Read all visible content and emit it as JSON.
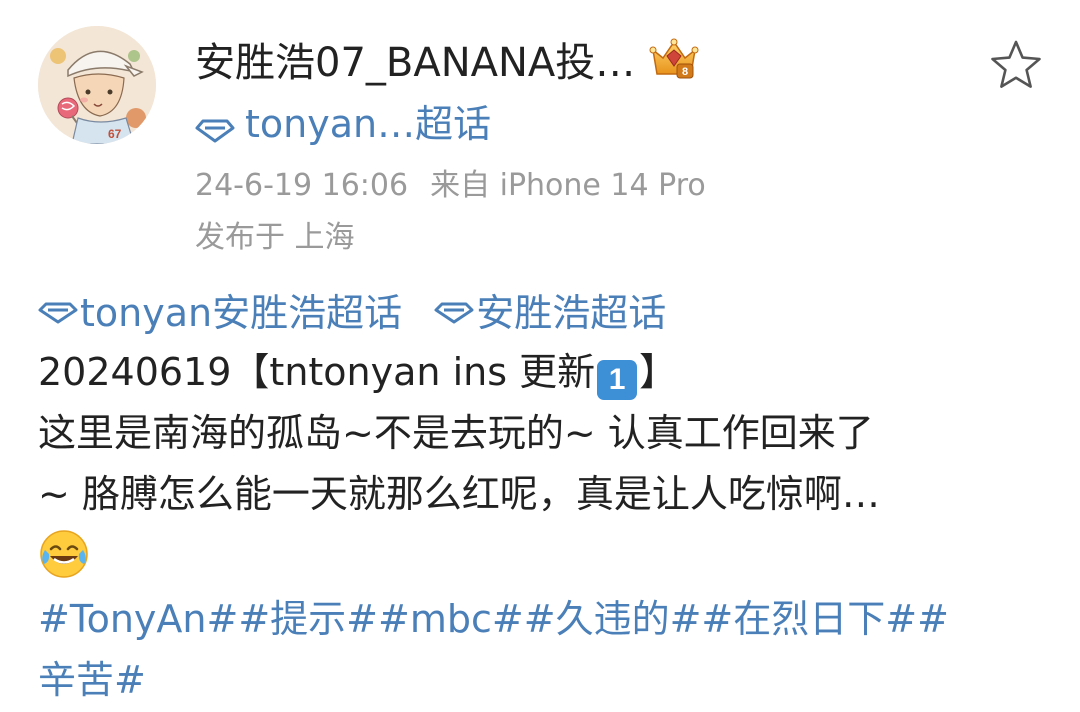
{
  "header": {
    "username": "安胜浩07_BANANA投…",
    "badge_icon": "crown-level-badge-icon",
    "badge_level": "8",
    "topic_label": "tonyan…超话",
    "timestamp": "24-6-19 16:06",
    "source": "来自 iPhone 14 Pro",
    "location": "发布于 上海",
    "favorite_icon": "star-outline-icon"
  },
  "post": {
    "topics": [
      "tonyan安胜浩超话",
      "安胜浩超话"
    ],
    "line2_prefix": "20240619【tntonyan ins 更新",
    "keycap_emoji": "1",
    "line2_suffix": "】",
    "line3": "这里是南海的孤岛~不是去玩的~ 认真工作回来了",
    "line4": "~ 胳膊怎么能一天就那么红呢，真是让人吃惊啊…",
    "emoji": "tears-of-joy-emoji",
    "hashtags_line1": "#TonyAn##提示##mbc##久违的##在烈日下##",
    "hashtags_line2": "辛苦#"
  },
  "colors": {
    "link": "#4a7fb8",
    "meta": "#9a9a9a",
    "text": "#222222",
    "keycap": "#3d8fd6"
  }
}
